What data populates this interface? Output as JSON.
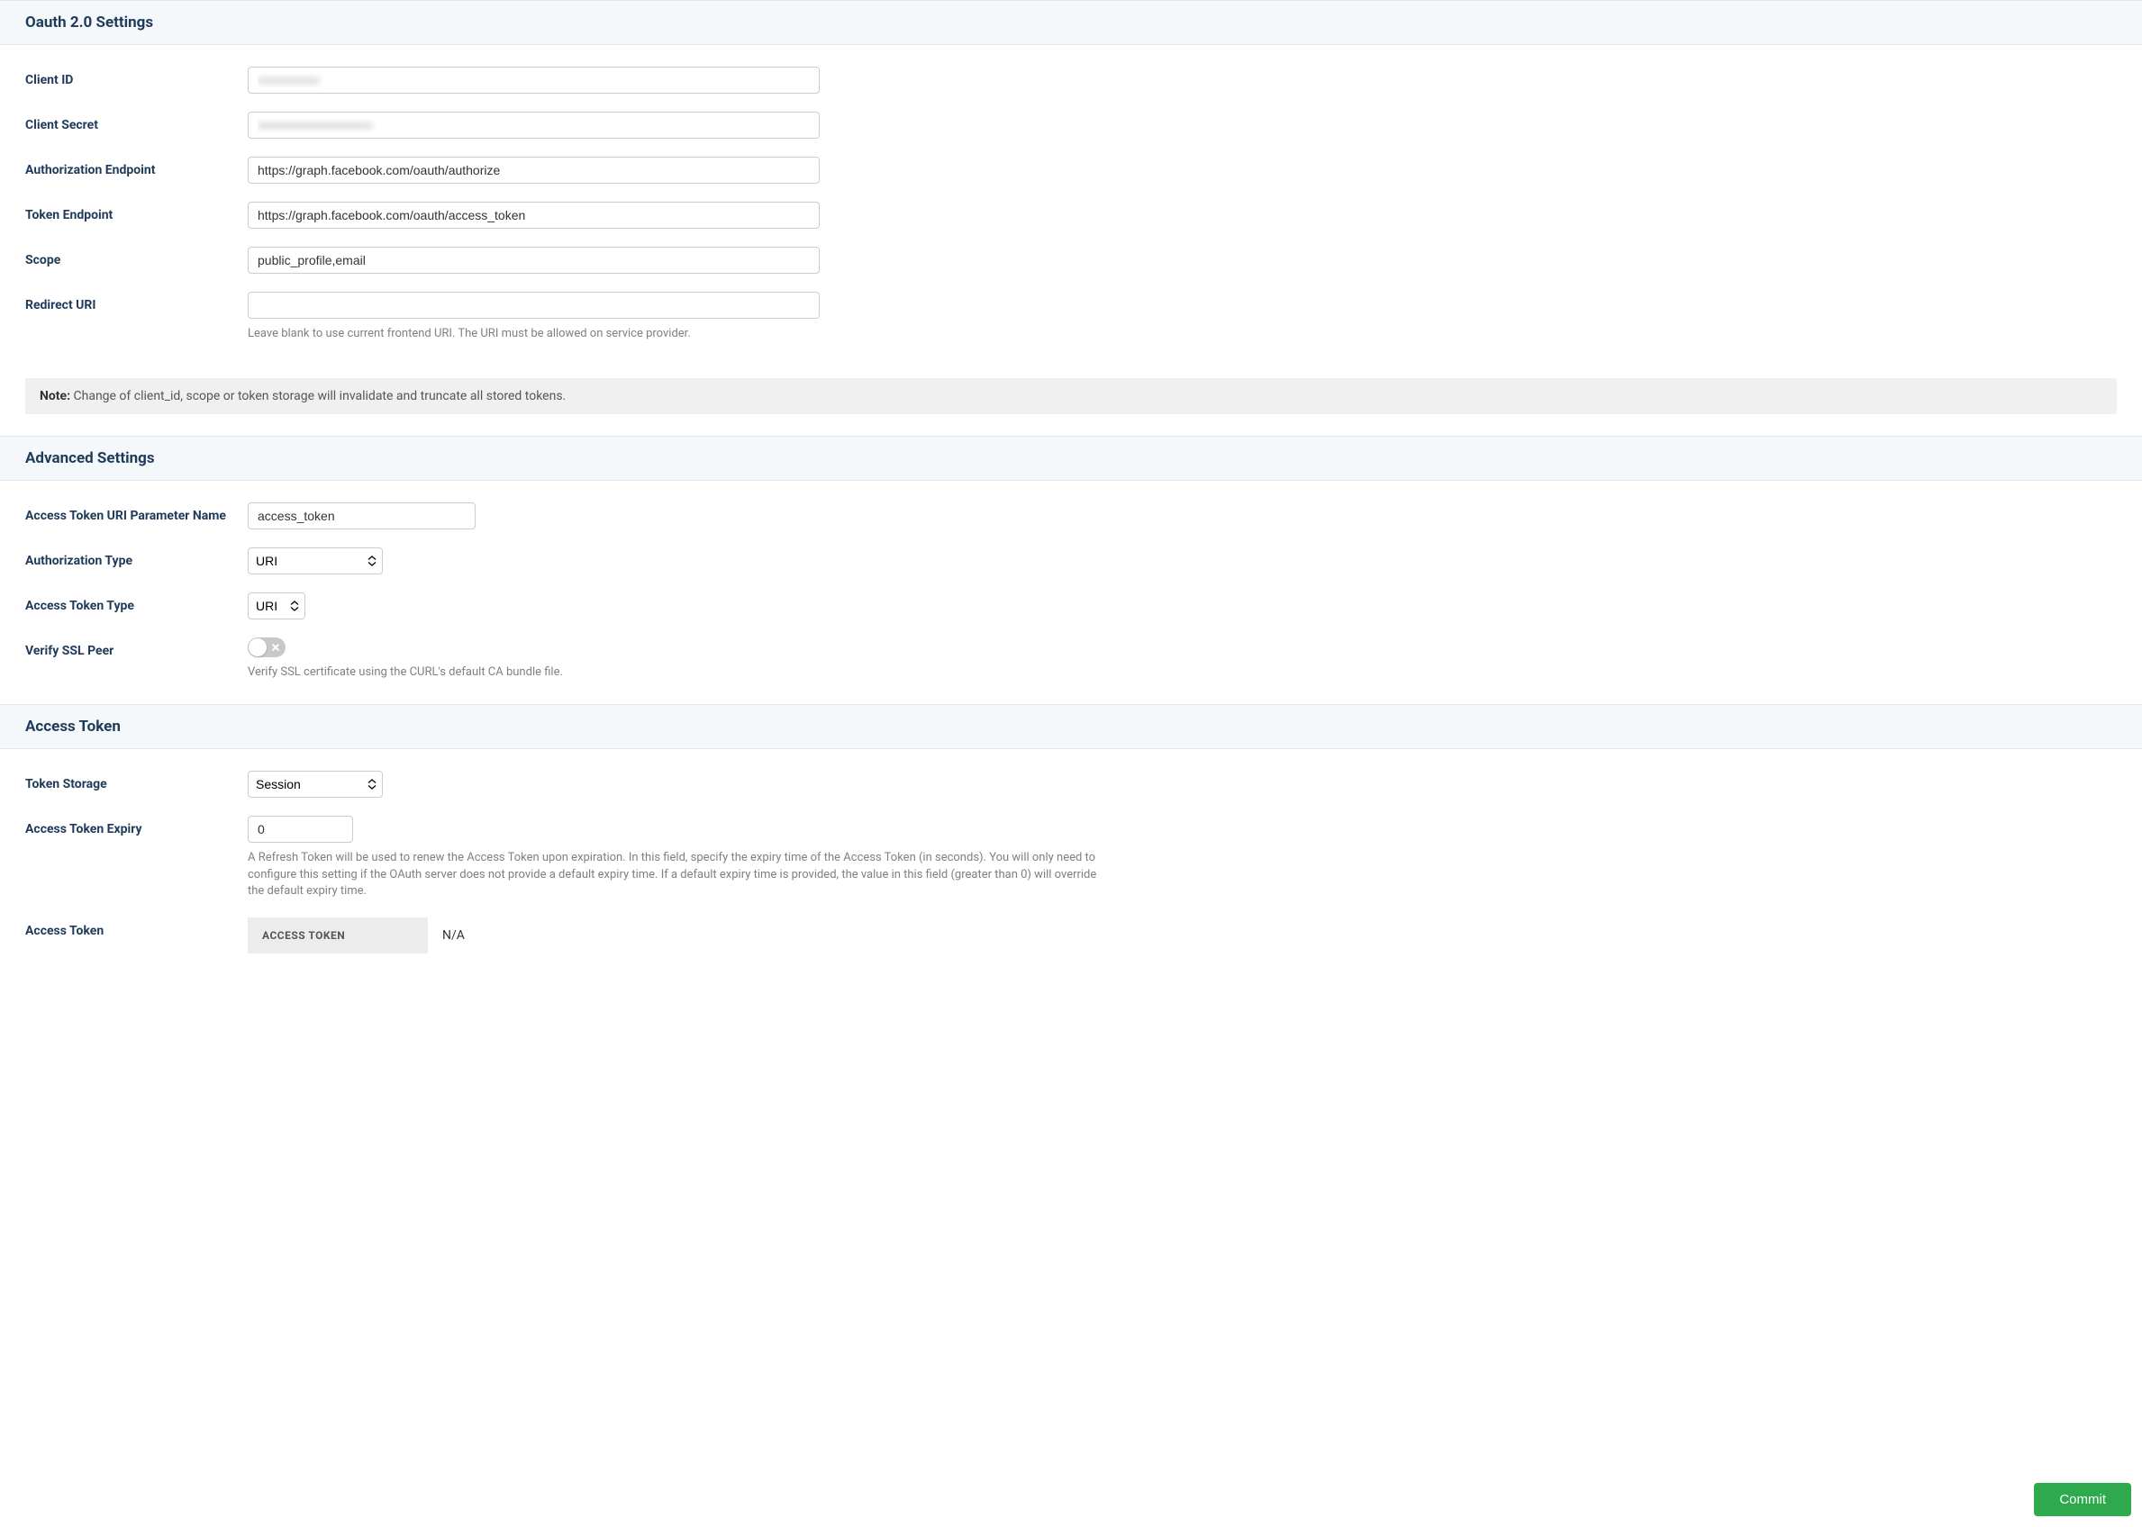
{
  "oauth": {
    "title": "Oauth 2.0 Settings",
    "client_id": {
      "label": "Client ID",
      "value": "••••••••••••••"
    },
    "client_secret": {
      "label": "Client Secret",
      "value": "••••••••••••••••••••••••••"
    },
    "auth_endpoint": {
      "label": "Authorization Endpoint",
      "value": "https://graph.facebook.com/oauth/authorize"
    },
    "token_endpoint": {
      "label": "Token Endpoint",
      "value": "https://graph.facebook.com/oauth/access_token"
    },
    "scope": {
      "label": "Scope",
      "value": "public_profile,email"
    },
    "redirect_uri": {
      "label": "Redirect URI",
      "value": "",
      "help": "Leave blank to use current frontend URI. The URI must be allowed on service provider."
    },
    "note_label": "Note:",
    "note_text": " Change of client_id, scope or token storage will invalidate and truncate all stored tokens."
  },
  "advanced": {
    "title": "Advanced Settings",
    "param_name": {
      "label": "Access Token URI Parameter Name",
      "value": "access_token"
    },
    "auth_type": {
      "label": "Authorization Type",
      "value": "URI"
    },
    "token_type": {
      "label": "Access Token Type",
      "value": "URI"
    },
    "verify_ssl": {
      "label": "Verify SSL Peer",
      "help": "Verify SSL certificate using the CURL's default CA bundle file."
    }
  },
  "access_token": {
    "title": "Access Token",
    "storage": {
      "label": "Token Storage",
      "value": "Session"
    },
    "expiry": {
      "label": "Access Token Expiry",
      "value": "0",
      "help": "A Refresh Token will be used to renew the Access Token upon expiration. In this field, specify the expiry time of the Access Token (in seconds). You will only need to configure this setting if the OAuth server does not provide a default expiry time. If a default expiry time is provided, the value in this field (greater than 0) will override the default expiry time."
    },
    "token": {
      "label": "Access Token",
      "th": "ACCESS TOKEN",
      "value": "N/A"
    }
  },
  "commit_label": "Commit"
}
